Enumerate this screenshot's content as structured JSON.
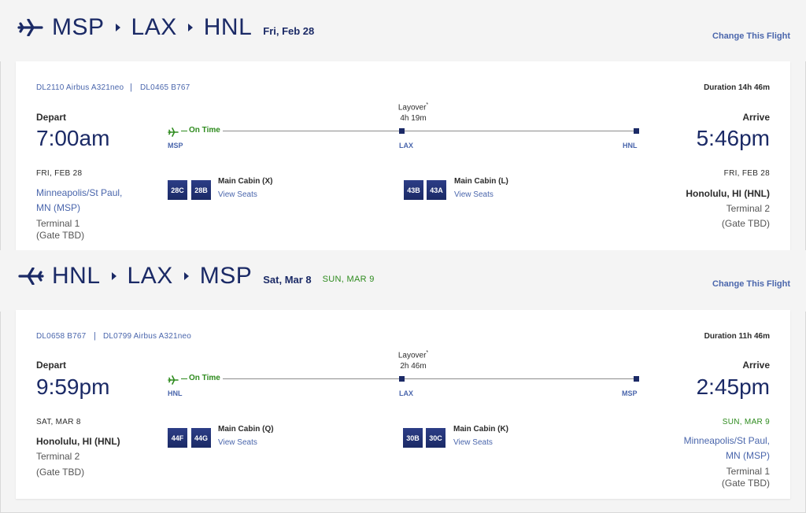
{
  "colors": {
    "navy": "#1b2a66",
    "link": "#4a66ac",
    "green": "#2e8b1e",
    "background": "#f4f4f4"
  },
  "legs": [
    {
      "route": [
        "MSP",
        "LAX",
        "HNL"
      ],
      "date": "Fri, Feb 28",
      "arrival_date_note": "",
      "change_label": "Change This Flight",
      "flights": [
        "DL2110  Airbus A321neo",
        "DL0465  B767"
      ],
      "duration": "Duration 14h 46m",
      "depart": {
        "label": "Depart",
        "time": "7:00am",
        "date": "FRI, FEB 28",
        "city_line1": "Minneapolis/St Paul,",
        "city_line2": "MN (MSP)",
        "terminal": "Terminal 1",
        "gate": "(Gate TBD)"
      },
      "arrive": {
        "label": "Arrive",
        "time": "5:46pm",
        "date": "FRI, FEB 28",
        "city_line1": "Honolulu, HI (HNL)",
        "city_line2": "",
        "terminal": "Terminal 2",
        "gate": "(Gate TBD)"
      },
      "layover": {
        "label": "Layover",
        "marker": "*",
        "duration": "4h 19m"
      },
      "status": "On Time",
      "airports": [
        "MSP",
        "LAX",
        "HNL"
      ],
      "segments": [
        {
          "seats": [
            "28C",
            "28B"
          ],
          "cabin": "Main Cabin (X)",
          "view": "View Seats"
        },
        {
          "seats": [
            "43B",
            "43A"
          ],
          "cabin": "Main Cabin (L)",
          "view": "View Seats"
        }
      ]
    },
    {
      "route": [
        "HNL",
        "LAX",
        "MSP"
      ],
      "date": "Sat, Mar 8",
      "arrival_date_note": "SUN, MAR 9",
      "change_label": "Change This Flight",
      "flights": [
        "DL0658  B767",
        "DL0799  Airbus A321neo"
      ],
      "duration": "Duration 11h 46m",
      "depart": {
        "label": "Depart",
        "time": "9:59pm",
        "date": "SAT, MAR 8",
        "city_line1": "Honolulu, HI (HNL)",
        "city_line2": "",
        "terminal": "Terminal 2",
        "gate": "(Gate TBD)"
      },
      "arrive": {
        "label": "Arrive",
        "time": "2:45pm",
        "date": "SUN, MAR 9",
        "city_line1": "Minneapolis/St Paul,",
        "city_line2": "MN (MSP)",
        "terminal": "Terminal 1",
        "gate": "(Gate TBD)"
      },
      "layover": {
        "label": "Layover",
        "marker": "*",
        "duration": "2h 46m"
      },
      "status": "On Time",
      "airports": [
        "HNL",
        "LAX",
        "MSP"
      ],
      "segments": [
        {
          "seats": [
            "44F",
            "44G"
          ],
          "cabin": "Main Cabin (Q)",
          "view": "View Seats"
        },
        {
          "seats": [
            "30B",
            "30C"
          ],
          "cabin": "Main Cabin (K)",
          "view": "View Seats"
        }
      ]
    }
  ]
}
